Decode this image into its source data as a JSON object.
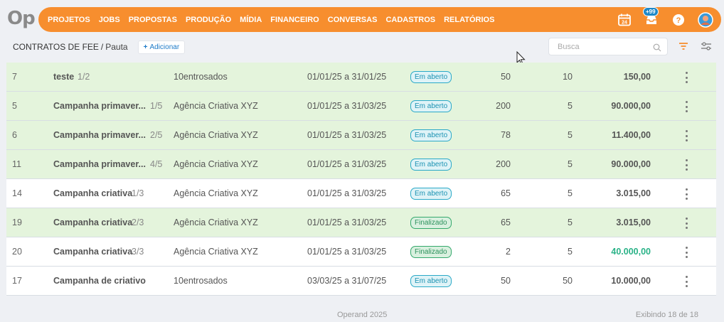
{
  "app": {
    "logo": "Op"
  },
  "nav": {
    "items": [
      "PROJETOS",
      "JOBS",
      "PROPOSTAS",
      "PRODUÇÃO",
      "MÍDIA",
      "FINANCEIRO",
      "CONVERSAS",
      "CADASTROS",
      "RELATÓRIOS"
    ],
    "calendar_day": "24",
    "notifications_badge": "+99"
  },
  "header": {
    "title": "CONTRATOS DE FEE",
    "separator": "/",
    "subtitle": "Pauta",
    "add_plus": "+",
    "add_label": "Adicionar",
    "search_placeholder": "Busca"
  },
  "rows": [
    {
      "id": "7",
      "name": "teste",
      "part": "1/2",
      "client": "10entrosados",
      "period": "01/01/25 a 31/01/25",
      "status": "Em aberto",
      "status_type": "open",
      "n1": "50",
      "n2": "10",
      "value": "150,00",
      "highlight": true,
      "value_green": false
    },
    {
      "id": "5",
      "name": "Campanha primaver...",
      "part": "1/5",
      "client": "Agência Criativa XYZ",
      "period": "01/01/25 a 31/03/25",
      "status": "Em aberto",
      "status_type": "open",
      "n1": "200",
      "n2": "5",
      "value": "90.000,00",
      "highlight": true,
      "value_green": false
    },
    {
      "id": "6",
      "name": "Campanha primaver...",
      "part": "2/5",
      "client": "Agência Criativa XYZ",
      "period": "01/01/25 a 31/03/25",
      "status": "Em aberto",
      "status_type": "open",
      "n1": "78",
      "n2": "5",
      "value": "11.400,00",
      "highlight": true,
      "value_green": false
    },
    {
      "id": "11",
      "name": "Campanha primaver...",
      "part": "4/5",
      "client": "Agência Criativa XYZ",
      "period": "01/01/25 a 31/03/25",
      "status": "Em aberto",
      "status_type": "open",
      "n1": "200",
      "n2": "5",
      "value": "90.000,00",
      "highlight": true,
      "value_green": false
    },
    {
      "id": "14",
      "name": "Campanha criativa",
      "part": "1/3",
      "client": "Agência Criativa XYZ",
      "period": "01/01/25 a 31/03/25",
      "status": "Em aberto",
      "status_type": "open",
      "n1": "65",
      "n2": "5",
      "value": "3.015,00",
      "highlight": false,
      "value_green": false
    },
    {
      "id": "19",
      "name": "Campanha criativa",
      "part": "2/3",
      "client": "Agência Criativa XYZ",
      "period": "01/01/25 a 31/03/25",
      "status": "Finalizado",
      "status_type": "done",
      "n1": "65",
      "n2": "5",
      "value": "3.015,00",
      "highlight": true,
      "value_green": false
    },
    {
      "id": "20",
      "name": "Campanha criativa",
      "part": "3/3",
      "client": "Agência Criativa XYZ",
      "period": "01/01/25 a 31/03/25",
      "status": "Finalizado",
      "status_type": "done",
      "n1": "2",
      "n2": "5",
      "value": "40.000,00",
      "highlight": false,
      "value_green": true
    },
    {
      "id": "17",
      "name": "Campanha de criativo",
      "part": "",
      "client": "10entrosados",
      "period": "03/03/25 a 31/07/25",
      "status": "Em aberto",
      "status_type": "open",
      "n1": "50",
      "n2": "50",
      "value": "10.000,00",
      "highlight": false,
      "value_green": false
    }
  ],
  "footer": {
    "copyright": "Operand 2025",
    "showing": "Exibindo 18  de 18"
  },
  "colors": {
    "brand_orange": "#f78e2e",
    "row_highlight": "#e4f4dc",
    "status_open": "#2aa9c7",
    "status_done": "#34a86b",
    "value_green": "#29b287"
  },
  "icons": {
    "calendar": "calendar-icon",
    "notifications": "inbox-icon",
    "help": "help-icon",
    "avatar": "avatar",
    "search": "search-icon",
    "filter": "filter-icon",
    "settings": "sliders-icon",
    "row_menu": "more-vertical-icon"
  }
}
